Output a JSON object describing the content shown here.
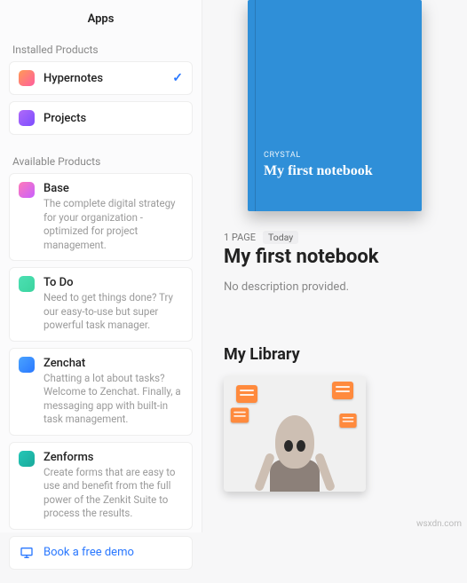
{
  "sidebar": {
    "title": "Apps",
    "installed_label": "Installed Products",
    "available_label": "Available Products",
    "installed": [
      {
        "name": "Hypernotes",
        "icon": "hypernotes",
        "selected": true
      },
      {
        "name": "Projects",
        "icon": "projects",
        "selected": false
      }
    ],
    "available": [
      {
        "name": "Base",
        "icon": "base",
        "desc": "The complete digital strategy for your organization - optimized for project management."
      },
      {
        "name": "To Do",
        "icon": "todo",
        "desc": "Need to get things done? Try our easy-to-use but super powerful task manager."
      },
      {
        "name": "Zenchat",
        "icon": "zenchat",
        "desc": "Chatting a lot about tasks? Welcome to Zenchat. Finally, a messaging app with built-in task management."
      },
      {
        "name": "Zenforms",
        "icon": "zenforms",
        "desc": "Create forms that are easy to use and benefit from the full power of the Zenkit Suite to process the results."
      }
    ],
    "demo_label": "Book a free demo"
  },
  "notebook": {
    "cover_author": "CRYSTAL",
    "cover_title": "My first notebook",
    "page_count": "1 PAGE",
    "date_badge": "Today",
    "title": "My first notebook",
    "description": "No description provided."
  },
  "library": {
    "heading": "My Library"
  },
  "watermark": "wsxdn.com"
}
